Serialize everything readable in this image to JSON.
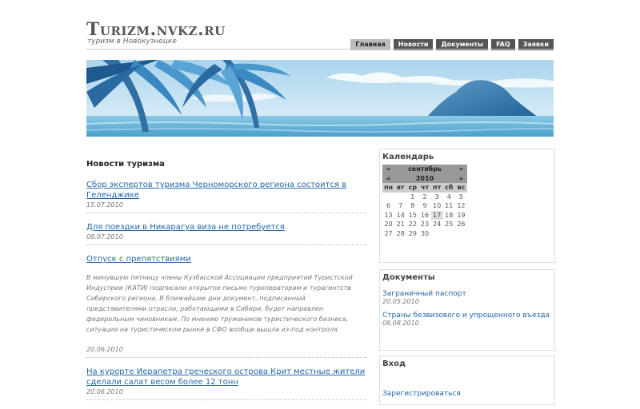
{
  "header": {
    "site_title": "Turizm.nvkz.ru",
    "site_subtitle": "туризм в Новокузнецке"
  },
  "nav": [
    {
      "label": "Главная",
      "active": true
    },
    {
      "label": "Новости",
      "active": false
    },
    {
      "label": "Документы",
      "active": false
    },
    {
      "label": "FAQ",
      "active": false
    },
    {
      "label": "Заявки",
      "active": false
    }
  ],
  "main": {
    "heading": "Новости туризма",
    "news": [
      {
        "title": "Сбор экспертов туризма Черноморского региона состоится в Геленджике",
        "date": "15.07.2010",
        "text": ""
      },
      {
        "title": "Для поездки в Никарагуа виза не потребуется",
        "date": "08.07.2010",
        "text": ""
      },
      {
        "title": "Отпуск с препятствиями",
        "date": "20.06.2010",
        "text": "В минувшую пятницу члены Кузбасской Ассоциации предприятий Туристской Индустрии (КАТИ) подписали открытое письмо туроператорам и турагентств Сибирского региона. В ближайшие дни документ, подписанный представителями отрасли, работающими в Сибири, будет направлен федеральным чиновникам. По мнению тружеников туристического бизнеса, ситуация на туристическом рынке в СФО вообще вышла из-под контроля."
      },
      {
        "title": "На курорте Иерапетра греческого острова Крит местные жители сделали салат весом более 12 тонн",
        "date": "20.06.2010",
        "text": ""
      }
    ]
  },
  "calendar": {
    "title": "Календарь",
    "prev": "«",
    "next": "»",
    "month": "сентябрь",
    "year": "2010",
    "weekdays": [
      "пн",
      "вт",
      "ср",
      "чт",
      "пт",
      "сб",
      "вс"
    ],
    "weeks": [
      [
        "",
        "",
        "1",
        "2",
        "3",
        "4",
        "5"
      ],
      [
        "6",
        "7",
        "8",
        "9",
        "10",
        "11",
        "12"
      ],
      [
        "13",
        "14",
        "15",
        "16",
        "17",
        "18",
        "19"
      ],
      [
        "20",
        "21",
        "22",
        "23",
        "24",
        "25",
        "26"
      ],
      [
        "27",
        "28",
        "29",
        "30",
        "",
        "",
        ""
      ]
    ],
    "today": "17"
  },
  "documents": {
    "title": "Документы",
    "items": [
      {
        "label": "Заграничный паспорт",
        "date": "20.05.2010"
      },
      {
        "label": "Страны безвизового и упрощенного въезда",
        "date": "08.08.2010"
      }
    ]
  },
  "login": {
    "title": "Вход",
    "register": "Зарегистрироваться"
  }
}
